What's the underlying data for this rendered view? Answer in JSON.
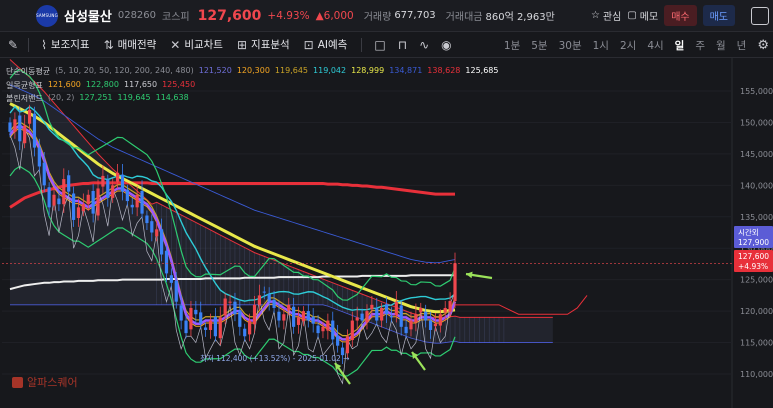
{
  "header": {
    "logo_text": "SAMSUNG",
    "name": "삼성물산",
    "code": "028260",
    "market": "코스피",
    "price": "127,600",
    "change_pct": "+4.93%",
    "change_val": "▲6,000",
    "volume_label": "거래량",
    "volume": "677,703",
    "amount_label": "거래대금",
    "amount": "860억 2,963만",
    "watch_label": "관심",
    "memo_label": "메모",
    "buy_label": "매수",
    "sell_label": "매도"
  },
  "toolbar": {
    "items": [
      "보조지표",
      "매매전략",
      "비교차트",
      "지표분석",
      "AI예측"
    ],
    "periods": [
      "1분",
      "5분",
      "30분",
      "1시",
      "2시",
      "4시",
      "일",
      "주",
      "월",
      "년"
    ],
    "active_period": "일"
  },
  "legends": {
    "ma_title": "단순이동평균",
    "ma_params": "(5, 10, 20, 50, 120, 200, 240, 480)",
    "ma_values": [
      "121,520",
      "120,300",
      "119,645",
      "119,042",
      "128,999",
      "134,871",
      "138,628",
      "125,685"
    ],
    "ma_colors": [
      "#6f6fd8",
      "#f5a623",
      "#c9a227",
      "#2ecbd6",
      "#e8e84a",
      "#3a5bd6",
      "#e8303a",
      "#ffffff"
    ],
    "ichi_title": "일목균형표",
    "ichi_values": [
      "121,600",
      "122,800",
      "117,650",
      "125,450"
    ],
    "ichi_colors": [
      "#f5a623",
      "#2ecc71",
      "#c9cad0",
      "#e8303a"
    ],
    "bb_title": "볼린저밴드",
    "bb_params": "(20, 2)",
    "bb_values": [
      "127,251",
      "119,645",
      "114,638"
    ],
    "bb_colors": [
      "#2ecc71",
      "#2ecc71",
      "#2ecc71"
    ]
  },
  "annotations": {
    "low_label": "최저 112,400 (+13.52%) - 2025.01.02 →",
    "last_time_label": "시간외",
    "last_time_price": "127,900",
    "last_price": "127,600",
    "last_pct": "+4.93%"
  },
  "watermark": "알파스퀘어",
  "chart_data": {
    "type": "candlestick",
    "ylim": [
      108000,
      158000
    ],
    "yticks": [
      110000,
      115000,
      120000,
      125000,
      130000,
      135000,
      140000,
      145000,
      150000,
      155000
    ],
    "ytick_labels": [
      "110,000",
      "115,000",
      "120,000",
      "125,000",
      "130,000",
      "135,000",
      "140,000",
      "145,000",
      "150,000",
      "155,000"
    ],
    "n_candles": 92,
    "closes": [
      148500,
      150500,
      147000,
      149500,
      152000,
      146000,
      143000,
      140000,
      136500,
      138500,
      137000,
      141000,
      139000,
      134500,
      136500,
      137000,
      138500,
      135500,
      139500,
      141500,
      138000,
      140000,
      142000,
      139000,
      137500,
      136500,
      138500,
      135500,
      134000,
      132500,
      133000,
      129000,
      126000,
      124500,
      121500,
      118500,
      116500,
      120500,
      119500,
      118000,
      117000,
      118500,
      116000,
      119000,
      122000,
      121500,
      119500,
      117500,
      116000,
      118500,
      121000,
      122500,
      123000,
      121500,
      120500,
      118500,
      119500,
      121000,
      117500,
      119000,
      120000,
      118500,
      118000,
      116500,
      117500,
      118500,
      115500,
      114500,
      113000,
      116000,
      118500,
      119000,
      118500,
      120000,
      121000,
      118500,
      120500,
      119500,
      119000,
      121500,
      117500,
      116500,
      118500,
      119500,
      120500,
      118500,
      117000,
      118000,
      119500,
      120500,
      121600,
      127600
    ],
    "ma_series": [
      {
        "name": "5",
        "values": [
          148000,
          149000,
          149500,
          149000,
          148500,
          147500,
          146000,
          144000,
          141500,
          140000,
          139000,
          138500,
          138000,
          137500,
          137500,
          137000,
          136500,
          137000,
          137500,
          138000,
          138500,
          139000,
          139500,
          139500,
          139000,
          138500,
          138000,
          137500,
          137000,
          136000,
          134500,
          132500,
          130500,
          128000,
          125000,
          122000,
          119500,
          118500,
          118000,
          118000,
          118500,
          118500,
          118500,
          118500,
          119000,
          119500,
          120000,
          120000,
          119000,
          118500,
          118500,
          119500,
          120500,
          121500,
          121500,
          121000,
          120500,
          120000,
          119500,
          119500,
          119000,
          119000,
          118500,
          118500,
          118000,
          117500,
          117000,
          116000,
          115500,
          115500,
          116000,
          116500,
          117500,
          118500,
          119500,
          119500,
          119500,
          120000,
          119500,
          119500,
          119000,
          119000,
          118500,
          118500,
          119000,
          119000,
          119000,
          118500,
          118500,
          119000,
          119500,
          121500
        ]
      },
      {
        "name": "120",
        "values": [
          154000,
          153600,
          153200,
          152800,
          152400,
          152000,
          151500,
          151000,
          150400,
          149800,
          149200,
          148600,
          148000,
          147400,
          146800,
          146200,
          145600,
          145000,
          144400,
          143900,
          143400,
          142900,
          142500,
          142100,
          141700,
          141300,
          140900,
          140500,
          140100,
          139700,
          139300,
          138900,
          138500,
          138100,
          137700,
          137300,
          136900,
          136500,
          136100,
          135700,
          135300,
          134900,
          134500,
          134100,
          133700,
          133300,
          132900,
          132500,
          132100,
          131700,
          131300,
          131000,
          130700,
          130400,
          130100,
          129800,
          129500,
          129200,
          128900,
          128600,
          128300,
          128000,
          127700,
          127400,
          127100,
          126800,
          126500,
          126200,
          125900,
          125600,
          125300,
          125000,
          124700,
          124400,
          124100,
          123800,
          123500,
          123200,
          122900,
          122600,
          122300,
          122000,
          121700,
          121500,
          121300,
          121100,
          121000,
          120900,
          120900,
          121000,
          121100,
          121200
        ]
      },
      {
        "name": "240",
        "values": [
          136500,
          137000,
          137500,
          138000,
          138300,
          138600,
          138900,
          139100,
          139300,
          139500,
          139700,
          139900,
          140000,
          140100,
          140200,
          140300,
          140300,
          140400,
          140400,
          140400,
          140400,
          140400,
          140400,
          140400,
          140400,
          140400,
          140400,
          140400,
          140400,
          140300,
          140300,
          140300,
          140300,
          140300,
          140300,
          140300,
          140300,
          140300,
          140300,
          140300,
          140300,
          140300,
          140300,
          140300,
          140300,
          140300,
          140300,
          140300,
          140300,
          140300,
          140300,
          140300,
          140300,
          140300,
          140300,
          140300,
          140300,
          140300,
          140300,
          140300,
          140300,
          140300,
          140300,
          140300,
          140300,
          140200,
          140200,
          140200,
          140100,
          140100,
          140000,
          140000,
          139900,
          139900,
          139800,
          139700,
          139700,
          139600,
          139500,
          139400,
          139300,
          139200,
          139100,
          139000,
          138900,
          138800,
          138700,
          138600,
          138600,
          138600,
          138600,
          138600
        ]
      },
      {
        "name": "480",
        "values": [
          123500,
          123700,
          123900,
          124100,
          124200,
          124300,
          124400,
          124500,
          124500,
          124600,
          124600,
          124700,
          124700,
          124700,
          124800,
          124800,
          124800,
          124800,
          124900,
          124900,
          124900,
          124900,
          124900,
          125000,
          125000,
          125000,
          125000,
          125000,
          125000,
          125000,
          125000,
          125000,
          125100,
          125100,
          125100,
          125100,
          125100,
          125100,
          125100,
          125100,
          125200,
          125200,
          125200,
          125200,
          125200,
          125200,
          125200,
          125200,
          125300,
          125300,
          125300,
          125300,
          125300,
          125300,
          125300,
          125400,
          125400,
          125400,
          125400,
          125400,
          125400,
          125400,
          125400,
          125400,
          125500,
          125500,
          125500,
          125500,
          125500,
          125500,
          125500,
          125500,
          125600,
          125600,
          125600,
          125600,
          125600,
          125600,
          125600,
          125600,
          125600,
          125600,
          125700,
          125700,
          125700,
          125700,
          125700,
          125700,
          125700,
          125700,
          125700,
          125700
        ]
      }
    ]
  }
}
